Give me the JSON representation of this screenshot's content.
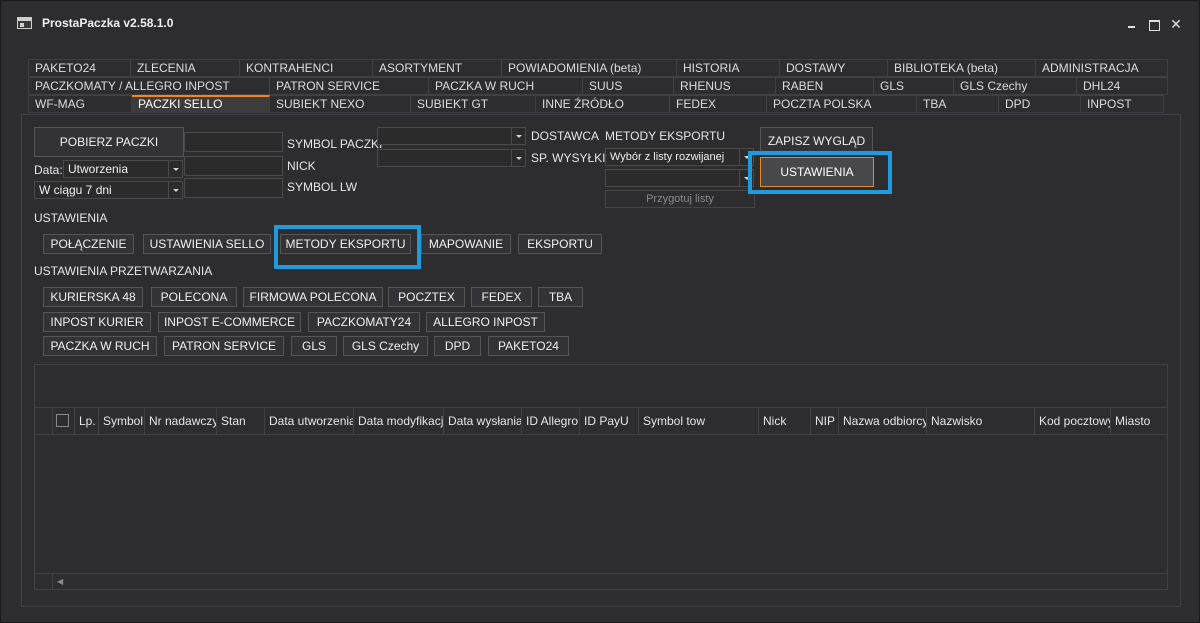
{
  "window": {
    "title": "ProstaPaczka v2.58.1.0"
  },
  "tabs": {
    "row1": [
      "PAKETO24",
      "ZLECENIA",
      "KONTRAHENCI",
      "ASORTYMENT",
      "POWIADOMIENIA (beta)",
      "HISTORIA",
      "DOSTAWY",
      "BIBLIOTEKA (beta)",
      "ADMINISTRACJA"
    ],
    "row2": [
      "PACZKOMATY / ALLEGRO INPOST",
      "PATRON SERVICE",
      "PACZKA W RUCH",
      "SUUS",
      "RHENUS",
      "RABEN",
      "GLS",
      "GLS Czechy",
      "DHL24"
    ],
    "row3": [
      "WF-MAG",
      "PACZKI SELLO",
      "SUBIEKT NEXO",
      "SUBIEKT GT",
      "INNE ŹRÓDŁO",
      "FEDEX",
      "POCZTA POLSKA",
      "TBA",
      "DPD",
      "INPOST"
    ],
    "active": "PACZKI SELLO"
  },
  "filters": {
    "fetch_button": "POBIERZ PACZKI",
    "date_label": "Data:",
    "date_type_value": "Utworzenia",
    "date_range_value": "W ciągu 7 dni",
    "symbol_paczki_label": "SYMBOL PACZKI",
    "nick_label": "NICK",
    "symbol_lw_label": "SYMBOL LW",
    "dostawca_label": "DOSTAWCA",
    "sp_wysylki_label": "SP. WYSYŁKI",
    "metody_eksportu_label": "METODY EKSPORTU",
    "metody_eksportu_value": "Wybór z listy rozwijanej",
    "przygotuj_button": "Przygotuj listy",
    "zapisz_button": "ZAPISZ WYGLĄD",
    "ustawienia_button": "USTAWIENIA"
  },
  "settings": {
    "heading": "USTAWIENIA",
    "buttons": [
      "POŁĄCZENIE",
      "USTAWIENIA SELLO",
      "METODY EKSPORTU",
      "MAPOWANIE",
      "EKSPORTU"
    ]
  },
  "processing": {
    "heading": "USTAWIENIA PRZETWARZANIA",
    "row1": [
      "KURIERSKA 48",
      "POLECONA",
      "FIRMOWA POLECONA",
      "POCZTEX",
      "FEDEX",
      "TBA"
    ],
    "row2": [
      "INPOST KURIER",
      "INPOST E-COMMERCE",
      "PACZKOMATY24",
      "ALLEGRO INPOST"
    ],
    "row3": [
      "PACZKA W RUCH",
      "PATRON SERVICE",
      "GLS",
      "GLS Czechy",
      "DPD",
      "PAKETO24"
    ]
  },
  "grid": {
    "columns": [
      "Lp.",
      "Symbol",
      "Nr nadawczy",
      "Stan",
      "Data utworzenia",
      "Data modyfikacji",
      "Data wysłania",
      "ID Allegro",
      "ID PayU",
      "Symbol tow",
      "Nick",
      "NIP",
      "Nazwa odbiorcy",
      "Nazwisko",
      "Kod pocztowy",
      "Miasto"
    ]
  },
  "colors": {
    "background": "#2d2d30",
    "accent_orange": "#e6892b",
    "highlight_blue": "#1d9bdc"
  },
  "icons": {
    "app": "app-window-icon",
    "minimize": "minimize-icon",
    "maximize": "maximize-icon",
    "close": "close-icon"
  }
}
